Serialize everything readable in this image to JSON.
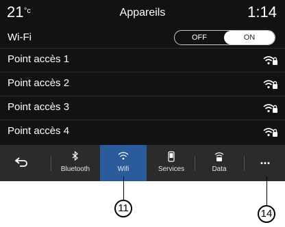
{
  "status": {
    "temperature": "21",
    "temp_unit": "°c",
    "title": "Appareils",
    "time": "1:14"
  },
  "wifi": {
    "label": "Wi-Fi",
    "off_label": "OFF",
    "on_label": "ON",
    "state": "ON"
  },
  "access_points": [
    {
      "name": "Point accès 1",
      "icon": "wifi-locked-icon"
    },
    {
      "name": "Point accès 2",
      "icon": "wifi-locked-icon"
    },
    {
      "name": "Point accès 3",
      "icon": "wifi-locked-icon"
    },
    {
      "name": "Point accès 4",
      "icon": "wifi-locked-icon"
    }
  ],
  "navbar": {
    "back_icon": "back-arrow-icon",
    "items": [
      {
        "label": "Bluetooth",
        "icon": "bluetooth-icon"
      },
      {
        "label": "Wifi",
        "icon": "wifi-icon",
        "active": true
      },
      {
        "label": "Services",
        "icon": "phone-services-icon"
      },
      {
        "label": "Data",
        "icon": "data-icon"
      }
    ],
    "more_label": "..."
  },
  "callouts": [
    {
      "label": "11"
    },
    {
      "label": "14"
    }
  ],
  "colors": {
    "accent": "#2a5c9c",
    "background": "#121212",
    "navbar": "#2b2b2b"
  }
}
